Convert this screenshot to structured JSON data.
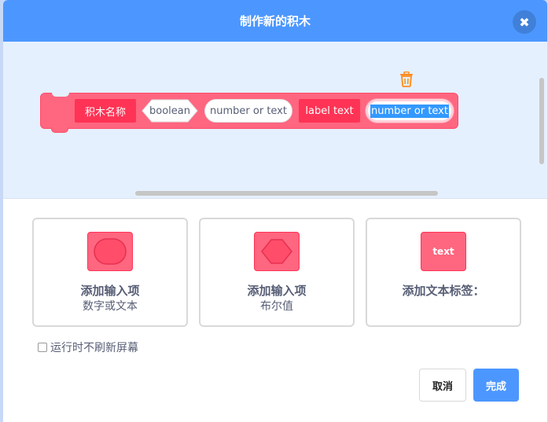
{
  "header": {
    "title": "制作新的积木",
    "close_label": "✖"
  },
  "block": {
    "name_label": "积木名称",
    "boolean_label": "boolean",
    "number_or_text_label": "number or text",
    "label_text": "label text",
    "active_input": "number or text"
  },
  "options": [
    {
      "title": "添加输入项",
      "subtitle": "数字或文本",
      "icon": "round-input-icon"
    },
    {
      "title": "添加输入项",
      "subtitle": "布尔值",
      "icon": "boolean-input-icon"
    },
    {
      "title": "添加文本标签：",
      "subtitle": "",
      "icon": "text-label-icon",
      "icon_text": "text"
    }
  ],
  "checkbox": {
    "label": "运行时不刷新屏幕",
    "checked": false
  },
  "buttons": {
    "cancel": "取消",
    "ok": "完成"
  },
  "colors": {
    "header": "#4c97ff",
    "block": "#ff6680",
    "block_label": "#ff3355",
    "workspace": "#e5f0ff",
    "ok_button": "#4c97ff"
  }
}
